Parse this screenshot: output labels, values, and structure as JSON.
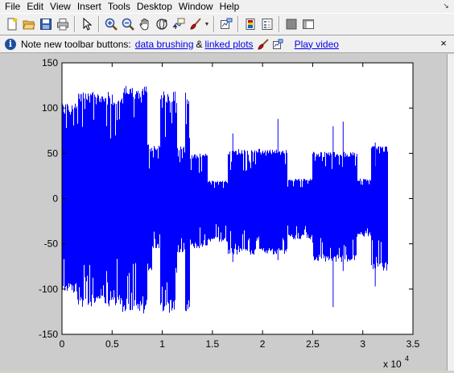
{
  "menu": [
    "File",
    "Edit",
    "View",
    "Insert",
    "Tools",
    "Desktop",
    "Window",
    "Help"
  ],
  "window_arrow": "↘",
  "toolbar": {
    "buttons": [
      {
        "name": "new-figure-icon"
      },
      {
        "name": "open-file-icon"
      },
      {
        "name": "save-figure-icon"
      },
      {
        "name": "print-figure-icon"
      },
      {
        "name": "sep"
      },
      {
        "name": "edit-plot-arrow-icon"
      },
      {
        "name": "sep"
      },
      {
        "name": "zoom-in-icon"
      },
      {
        "name": "zoom-out-icon"
      },
      {
        "name": "pan-hand-icon"
      },
      {
        "name": "rotate-3d-icon"
      },
      {
        "name": "data-cursor-icon"
      },
      {
        "name": "brush-icon"
      },
      {
        "name": "dropdown"
      },
      {
        "name": "sep"
      },
      {
        "name": "link-plot-icon"
      },
      {
        "name": "sep"
      },
      {
        "name": "insert-colorbar-icon"
      },
      {
        "name": "insert-legend-icon"
      },
      {
        "name": "sep"
      },
      {
        "name": "hide-plot-tools-icon"
      },
      {
        "name": "show-plot-tools-icon"
      }
    ]
  },
  "infobar": {
    "text": "Note new toolbar buttons:",
    "link1": "data brushing",
    "amp": "&",
    "link2": "linked plots",
    "link3": "Play video",
    "close": "×"
  },
  "colors": {
    "signal": "#0000ff",
    "background": "#cccccc",
    "axes_bg": "#ffffff"
  },
  "chart_data": {
    "type": "line",
    "title": "",
    "xlabel": "",
    "ylabel": "",
    "xlim": [
      0,
      35000
    ],
    "ylim": [
      -150,
      150
    ],
    "x_ticks": [
      0,
      5000,
      10000,
      15000,
      20000,
      25000,
      30000,
      35000
    ],
    "x_tick_labels": [
      "0",
      "0.5",
      "1",
      "1.5",
      "2",
      "2.5",
      "3",
      "3.5"
    ],
    "x_exponent_label": "x 10",
    "x_exponent_power": "4",
    "y_ticks": [
      -150,
      -100,
      -50,
      0,
      50,
      100,
      150
    ],
    "y_tick_labels": [
      "-150",
      "-100",
      "-50",
      "0",
      "50",
      "100",
      "150"
    ],
    "grid": false,
    "series": [
      {
        "envelope": [
          {
            "x0": 0,
            "x1": 1500,
            "top": 105,
            "bottom": -105
          },
          {
            "x0": 1500,
            "x1": 3000,
            "top": 120,
            "bottom": -120
          },
          {
            "x0": 3000,
            "x1": 6000,
            "top": 118,
            "bottom": -120
          },
          {
            "x0": 6000,
            "x1": 8500,
            "top": 125,
            "bottom": -127
          },
          {
            "x0": 8500,
            "x1": 9000,
            "top": 60,
            "bottom": -80
          },
          {
            "x0": 9000,
            "x1": 9800,
            "top": 60,
            "bottom": -55
          },
          {
            "x0": 9800,
            "x1": 11500,
            "top": 120,
            "bottom": -127
          },
          {
            "x0": 11500,
            "x1": 12300,
            "top": 60,
            "bottom": -60
          },
          {
            "x0": 12300,
            "x1": 12800,
            "top": 118,
            "bottom": -125
          },
          {
            "x0": 12800,
            "x1": 14500,
            "top": 50,
            "bottom": -55
          },
          {
            "x0": 14500,
            "x1": 16500,
            "top": 20,
            "bottom": -48
          },
          {
            "x0": 16500,
            "x1": 22500,
            "top": 55,
            "bottom": -62
          },
          {
            "x0": 22500,
            "x1": 25000,
            "top": 22,
            "bottom": -45
          },
          {
            "x0": 25000,
            "x1": 29500,
            "top": 52,
            "bottom": -70
          },
          {
            "x0": 29500,
            "x1": 30800,
            "top": 22,
            "bottom": -42
          },
          {
            "x0": 30800,
            "x1": 32500,
            "top": 58,
            "bottom": -80
          }
        ],
        "spikes": [
          {
            "x": 3800,
            "top": 100,
            "bottom": -110
          },
          {
            "x": 17000,
            "top": 72,
            "bottom": -70
          },
          {
            "x": 21500,
            "top": 88,
            "bottom": -68
          },
          {
            "x": 27000,
            "top": 80,
            "bottom": -120
          },
          {
            "x": 28000,
            "top": 85,
            "bottom": -80
          },
          {
            "x": 31200,
            "top": 62,
            "bottom": -97
          }
        ]
      }
    ]
  }
}
